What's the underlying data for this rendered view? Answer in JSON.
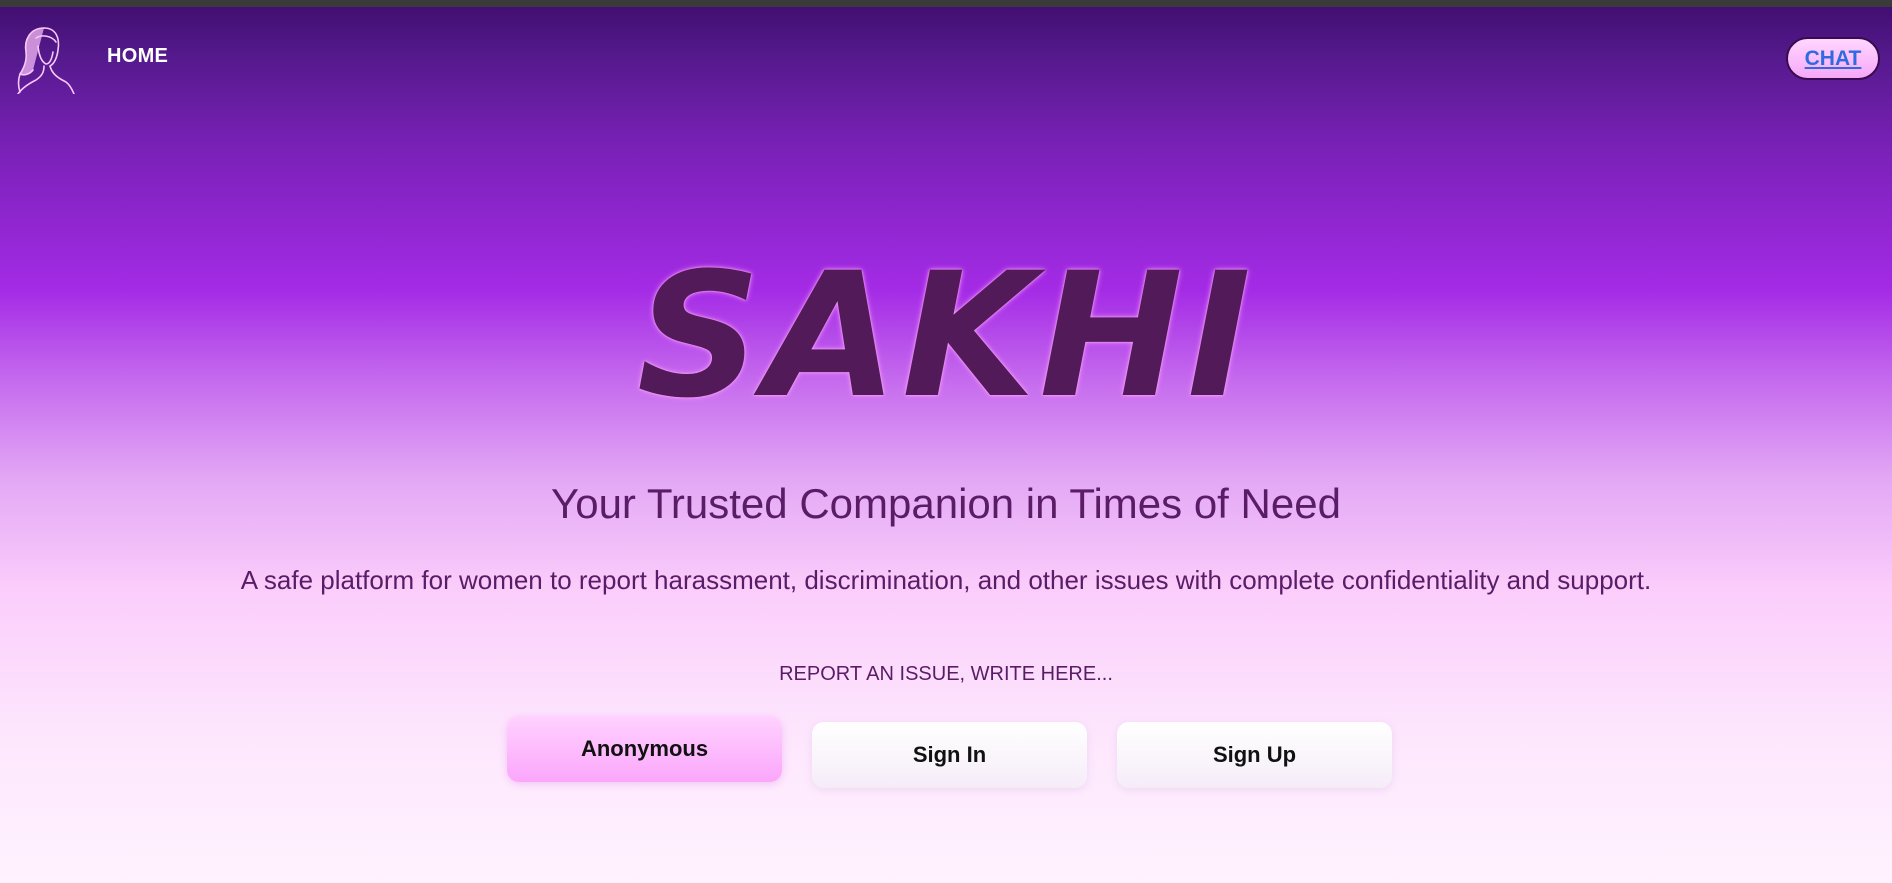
{
  "nav": {
    "logo_icon": "woman-silhouette-icon",
    "home_label": "HOME",
    "chat_label": "CHAT"
  },
  "hero": {
    "brand": "SAKHI",
    "tagline": "Your Trusted Companion in Times of Need",
    "description": "A safe platform for women to report harassment, discrimination, and other issues with complete confidentiality and support."
  },
  "report": {
    "prompt": "REPORT AN ISSUE, WRITE HERE...",
    "buttons": {
      "anonymous": "Anonymous",
      "sign_in": "Sign In",
      "sign_up": "Sign Up"
    }
  },
  "colors": {
    "title": "#531a5a",
    "text": "#5a1c66",
    "chat_link": "#2f6bde",
    "gradient_top": "#3f0d6e",
    "gradient_mid": "#a42be6",
    "gradient_bottom": "#fff3fe"
  }
}
